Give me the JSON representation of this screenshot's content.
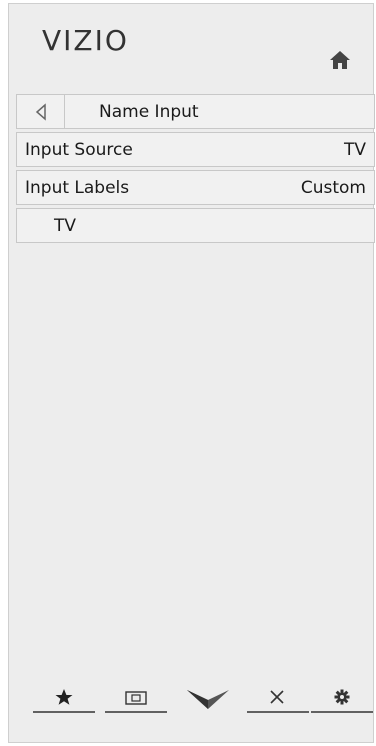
{
  "app": {
    "logo": "VIZIO"
  },
  "menu": {
    "header_title": "Name Input",
    "rows": [
      {
        "label": "Input Source",
        "value": "TV"
      },
      {
        "label": "Input Labels",
        "value": "Custom"
      }
    ],
    "entry": "TV"
  },
  "bottom_nav": {
    "items": [
      "star-icon",
      "picture-icon",
      "vizio-v-icon",
      "close-icon",
      "gear-icon"
    ]
  },
  "colors": {
    "background": "#ededed",
    "row_border": "#c8c8c8",
    "text": "#1a1a1a"
  }
}
